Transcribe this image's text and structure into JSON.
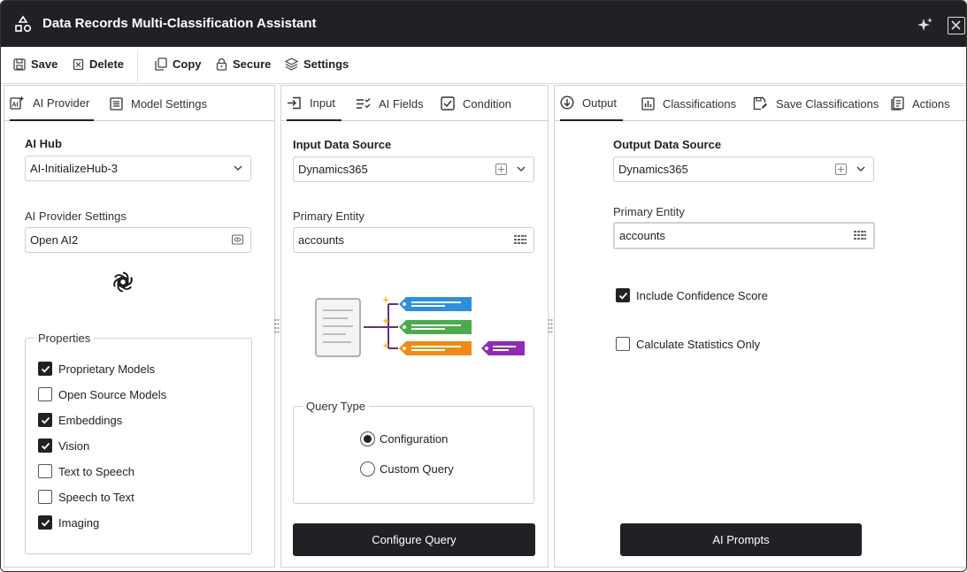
{
  "window": {
    "title": "Data Records Multi-Classification Assistant"
  },
  "toolbar": {
    "save": "Save",
    "delete": "Delete",
    "copy": "Copy",
    "secure": "Secure",
    "settings": "Settings"
  },
  "left_panel": {
    "tabs": [
      "AI Provider",
      "Model Settings"
    ],
    "ai_hub_label": "AI Hub",
    "ai_hub_value": "AI-InitializeHub-3",
    "provider_settings_label": "AI Provider Settings",
    "provider_settings_value": "Open AI2",
    "provider_logo": "openai-logo",
    "properties_legend": "Properties",
    "properties": [
      {
        "label": "Proprietary Models",
        "checked": true
      },
      {
        "label": "Open Source Models",
        "checked": false
      },
      {
        "label": "Embeddings",
        "checked": true
      },
      {
        "label": "Vision",
        "checked": true
      },
      {
        "label": "Text to Speech",
        "checked": false
      },
      {
        "label": "Speech to Text",
        "checked": false
      },
      {
        "label": "Imaging",
        "checked": true
      }
    ]
  },
  "middle_panel": {
    "tabs": [
      "Input",
      "AI Fields",
      "Condition"
    ],
    "input_source_label": "Input Data Source",
    "input_source_value": "Dynamics365",
    "primary_entity_label": "Primary Entity",
    "primary_entity_value": "accounts",
    "query_type_legend": "Query Type",
    "query_options": [
      {
        "label": "Configuration",
        "selected": true
      },
      {
        "label": "Custom Query",
        "selected": false
      }
    ],
    "configure_button": "Configure Query"
  },
  "right_panel": {
    "tabs": [
      "Output",
      "Classifications",
      "Save Classifications",
      "Actions"
    ],
    "output_source_label": "Output Data Source",
    "output_source_value": "Dynamics365",
    "primary_entity_label": "Primary Entity",
    "primary_entity_value": "accounts",
    "include_confidence": {
      "label": "Include Confidence Score",
      "checked": true
    },
    "calc_stats": {
      "label": "Calculate Statistics Only",
      "checked": false
    },
    "prompts_button": "AI Prompts"
  },
  "colors": {
    "titlebar": "#202124",
    "button_dark": "#202124",
    "tag_blue": "#2f8fdc",
    "tag_green": "#4caa4c",
    "tag_orange": "#f08a16",
    "tag_purple": "#8e2bb5"
  }
}
